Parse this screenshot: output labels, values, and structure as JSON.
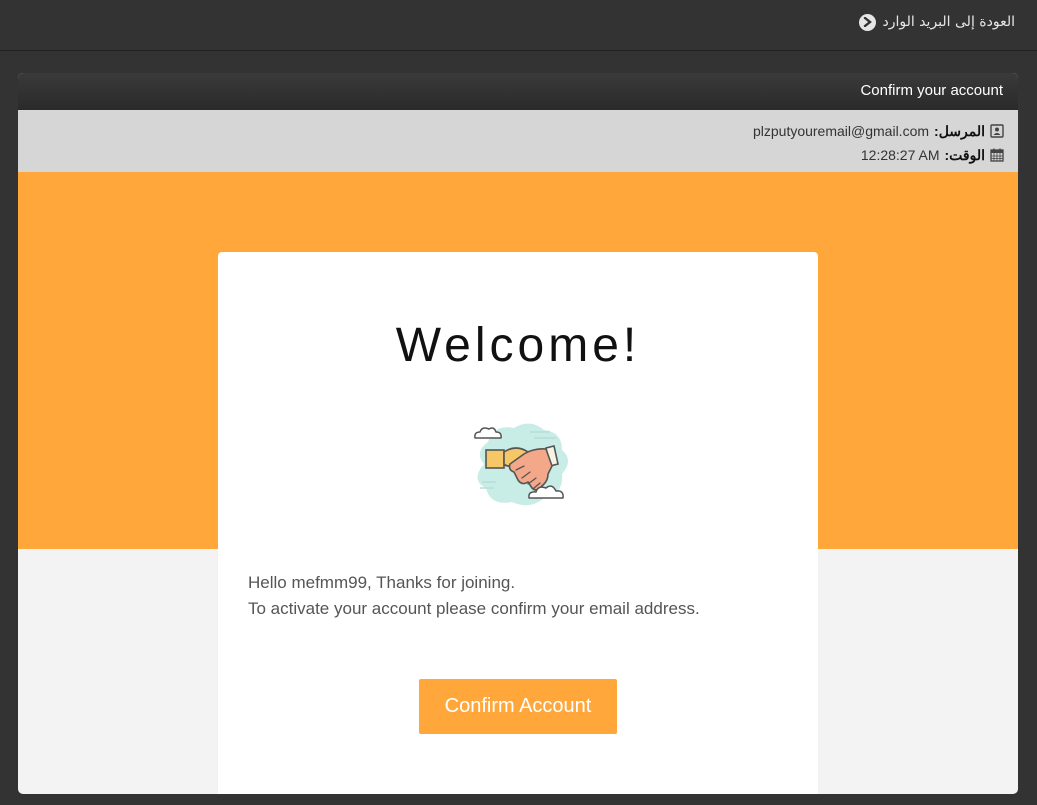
{
  "topbar": {
    "back_label": "العودة إلى البريد الوارد",
    "back_icon": "chevron-circle-right-icon"
  },
  "email": {
    "subject": "Confirm your account",
    "sender_label": "المرسل:",
    "sender_value": "plzputyouremail@gmail.com",
    "sender_icon": "contact-card-icon",
    "time_label": "الوقت:",
    "time_value": "12:28:27 AM",
    "time_icon": "calendar-icon"
  },
  "content": {
    "heading": "Welcome!",
    "illustration": "handshake-clouds-illustration",
    "message_line1": "Hello mefmm99, Thanks for joining.",
    "message_line2": "To activate your account please confirm your email address.",
    "button_label": "Confirm Account"
  },
  "colors": {
    "accent": "#ffa73b",
    "background": "#333333",
    "body": "#f3f3f3",
    "meta_bar": "#d6d6d6"
  }
}
